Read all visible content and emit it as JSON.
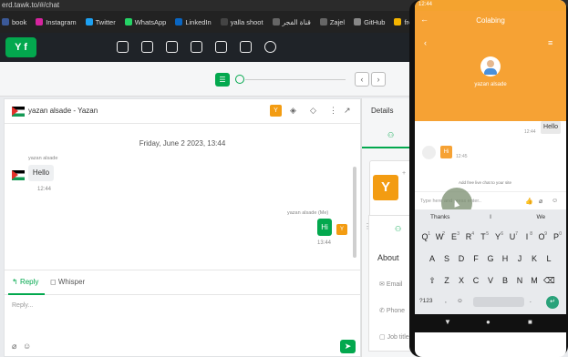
{
  "browser": {
    "url": "erd.tawk.to/#/chat",
    "bookmarks": [
      {
        "label": "book",
        "color": "#3b5998"
      },
      {
        "label": "Instagram",
        "color": "#d6249f"
      },
      {
        "label": "Twitter",
        "color": "#1da1f2"
      },
      {
        "label": "WhatsApp",
        "color": "#25d366"
      },
      {
        "label": "LinkedIn",
        "color": "#0a66c2"
      },
      {
        "label": "yalla shoot",
        "color": "#444444"
      },
      {
        "label": "قناة الفجر",
        "color": "#666666"
      },
      {
        "label": "Zajel",
        "color": "#666666"
      },
      {
        "label": "GitHub",
        "color": "#888888"
      },
      {
        "label": "front",
        "color": "#f4b400"
      }
    ]
  },
  "app": {
    "logo": "Y f"
  },
  "chat": {
    "header_name": "yazan alsade - Yazan",
    "header_badge": "Y",
    "date": "Friday, June 2 2023, 13:44",
    "incoming": {
      "sender": "yazan alsade",
      "text": "Hello",
      "time": "12:44"
    },
    "outgoing": {
      "sender": "yazan alsade (Me)",
      "text": "Hi",
      "time": "13:44",
      "avatar": "Y"
    },
    "tabs": {
      "reply": "Reply",
      "whisper": "Whisper"
    },
    "reply_placeholder": "Reply..."
  },
  "details": {
    "title": "Details",
    "avatar_letter": "Y",
    "about": "About",
    "rows": [
      "Email",
      "Phone",
      "Job title"
    ]
  },
  "phone": {
    "status_time": "12:44",
    "title": "Colabing",
    "visitor_name": "yazan alsade",
    "out_msg": "Hello",
    "out_time": "12:44",
    "in_msg": "Hi",
    "in_time": "12:45",
    "add_free": "Add free live chat to your site",
    "input_placeholder": "Type here and press enter..",
    "suggestions": [
      "Thanks",
      "I",
      "We"
    ],
    "keyboard": {
      "row1": [
        "Q",
        "W",
        "E",
        "R",
        "T",
        "Y",
        "U",
        "I",
        "O",
        "P"
      ],
      "row1_nums": [
        "1",
        "2",
        "3",
        "4",
        "5",
        "6",
        "7",
        "8",
        "9",
        "0"
      ],
      "row2": [
        "A",
        "S",
        "D",
        "F",
        "G",
        "H",
        "J",
        "K",
        "L"
      ],
      "row3": [
        "Z",
        "X",
        "C",
        "V",
        "B",
        "N",
        "M"
      ],
      "sym": "?123",
      "comma": ",",
      "period": "."
    }
  },
  "colors": {
    "tawk_green": "#03a84e",
    "orange": "#f6a234",
    "nav_dark": "#1f2328"
  }
}
